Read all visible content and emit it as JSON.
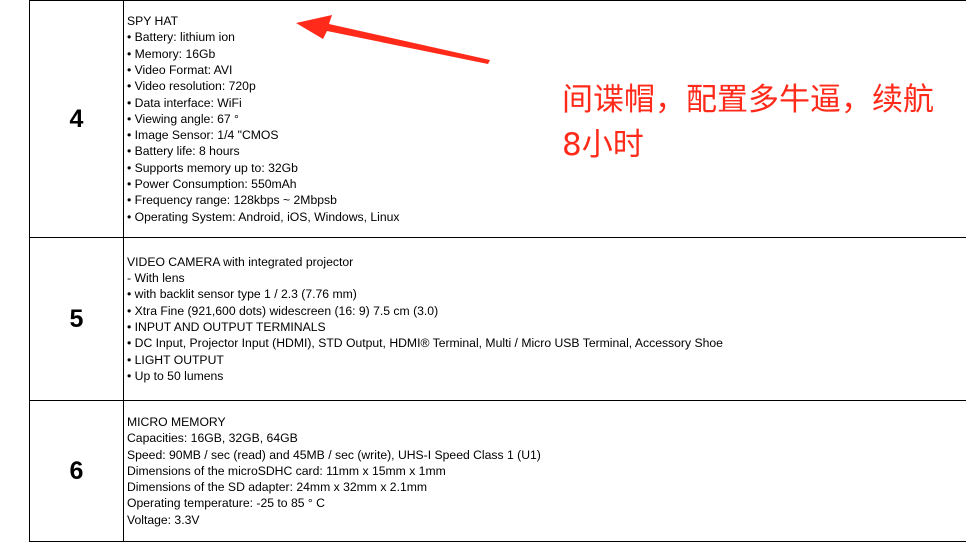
{
  "rows": [
    {
      "number": "4",
      "lines": [
        "SPY HAT",
        "• Battery: lithium ion",
        "• Memory: 16Gb",
        "• Video Format: AVI",
        "• Video resolution: 720p",
        "• Data interface: WiFi",
        "• Viewing angle: 67 °",
        "• Image Sensor: 1/4 \"CMOS",
        "• Battery life: 8 hours",
        "• Supports memory up to: 32Gb",
        "• Power Consumption: 550mAh",
        "• Frequency range: 128kbps ~ 2Mbpsb",
        "• Operating System: Android, iOS, Windows, Linux"
      ]
    },
    {
      "number": "5",
      "lines": [
        "VIDEO CAMERA with integrated projector",
        "- With lens",
        "• with backlit sensor type 1 / 2.3 (7.76 mm)",
        "• Xtra Fine (921,600 dots) widescreen (16: 9) 7.5 cm (3.0)",
        "• INPUT AND OUTPUT TERMINALS",
        "• DC Input, Projector Input (HDMI), STD Output, HDMI® Terminal, Multi / Micro USB Terminal, Accessory Shoe",
        "• LIGHT OUTPUT",
        "• Up to 50 lumens"
      ]
    },
    {
      "number": "6",
      "lines": [
        "MICRO MEMORY",
        "Capacities: 16GB, 32GB, 64GB",
        "Speed: 90MB / sec (read) and 45MB / sec (write), UHS-I Speed Class 1 (U1)",
        "Dimensions of the microSDHC card: 11mm x 15mm x 1mm",
        "Dimensions of the SD adapter: 24mm x 32mm x 2.1mm",
        "Operating temperature: -25 to 85 ° C",
        "Voltage: 3.3V"
      ]
    }
  ],
  "annotation": {
    "text": "间谍帽，配置多牛逼，续航8小时",
    "color": "#ff2a1a"
  }
}
